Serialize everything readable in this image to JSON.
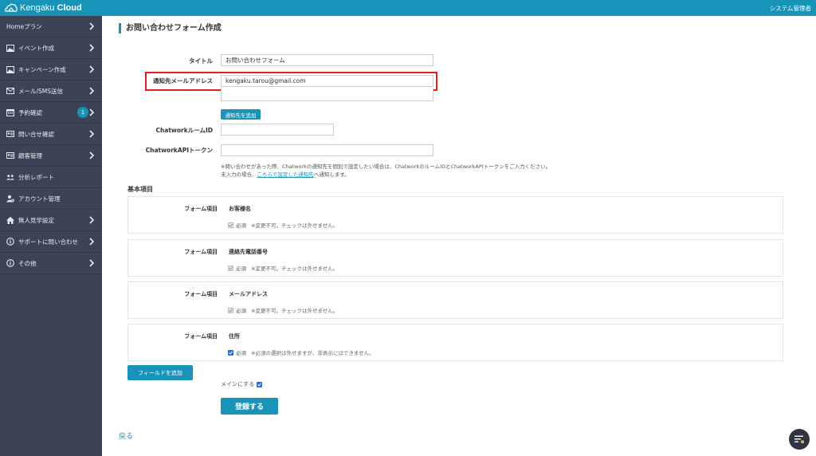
{
  "app": {
    "logo_text_light": "Kengaku",
    "logo_text_bold": "Cloud",
    "user_role": "システム管理者"
  },
  "sidebar": {
    "items": [
      {
        "label": "Homeプラン",
        "icon": "none",
        "has_chevron": true
      },
      {
        "label": "イベント作成",
        "icon": "image-icon",
        "has_chevron": true
      },
      {
        "label": "キャンペーン作成",
        "icon": "image-icon",
        "has_chevron": true
      },
      {
        "label": "メール/SMS送信",
        "icon": "envelope-icon",
        "has_chevron": true
      },
      {
        "label": "予約確認",
        "icon": "calendar-icon",
        "has_chevron": true,
        "badge": "1"
      },
      {
        "label": "問い合せ確認",
        "icon": "id-card-icon",
        "has_chevron": true
      },
      {
        "label": "顧客管理",
        "icon": "id-card-icon",
        "has_chevron": true
      },
      {
        "label": "分析レポート",
        "icon": "users-icon",
        "has_chevron": false
      },
      {
        "label": "アカウント管理",
        "icon": "user-gear-icon",
        "has_chevron": false
      },
      {
        "label": "無人見学設定",
        "icon": "home-icon",
        "has_chevron": true
      },
      {
        "label": "サポートに問い合わせ",
        "icon": "info-icon",
        "has_chevron": true
      },
      {
        "label": "その他",
        "icon": "info-icon",
        "has_chevron": true
      }
    ]
  },
  "page": {
    "title": "お問い合わせフォーム作成"
  },
  "form": {
    "title_label": "タイトル",
    "title_value": "お問い合わせフォーム",
    "email_label": "通知先メールアドレス",
    "email_value": "kengaku.tarou@gmail.com",
    "email_value_2": "",
    "add_recipient_label": "通知先を追加",
    "chatwork_room_label": "ChatworkルームID",
    "chatwork_room_value": "",
    "chatwork_token_label": "ChatworkAPIトークン",
    "chatwork_token_value": "",
    "note_line1": "※問い合わせがあった際、Chatworkの通知先を個別で設定したい場合は、ChatworkのルームIDとChatworkAPIトークンをご入力ください。",
    "note_line2_prefix": "未入力の場合、",
    "note_line2_link": "こちらで設定した通知先",
    "note_line2_suffix": "へ通知します。"
  },
  "basic_items": {
    "section_title": "基本項目",
    "field_label": "フォーム項目",
    "required_label": "必須",
    "fields": [
      {
        "name": "お客様名",
        "checked": true,
        "disabled": true,
        "note": "※変更不可。チェックは外せません。"
      },
      {
        "name": "連絡先電話番号",
        "checked": true,
        "disabled": true,
        "note": "※変更不可。チェックは外せません。"
      },
      {
        "name": "メールアドレス",
        "checked": true,
        "disabled": true,
        "note": "※変更不可。チェックは外せません。"
      },
      {
        "name": "住所",
        "checked": true,
        "disabled": false,
        "note": "※必須の選択は外せますが、非表示にはできません。"
      }
    ]
  },
  "actions": {
    "add_field_label": "フィールドを追加",
    "main_toggle_label": "メインにする",
    "main_toggle_checked": true,
    "submit_label": "登録する",
    "back_label": "戻る"
  },
  "colors": {
    "brand": "#1a93b8",
    "sidebar_bg": "#3b4457",
    "highlight": "#e01f1f",
    "checkbox_on": "#1e6fd9"
  }
}
